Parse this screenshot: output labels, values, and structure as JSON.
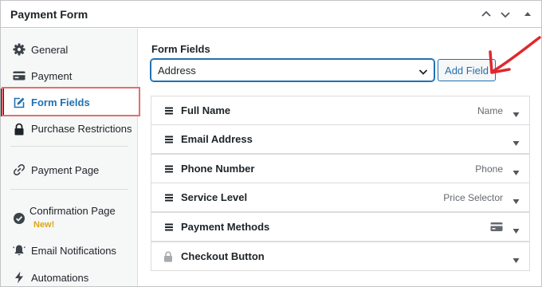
{
  "window": {
    "title": "Payment Form",
    "controls": [
      "collapse-up-icon",
      "move-down-icon",
      "toggle-panel-icon"
    ]
  },
  "sidebar": {
    "items": [
      {
        "label": "General",
        "icon": "gear-icon"
      },
      {
        "label": "Payment",
        "icon": "card-icon"
      },
      {
        "label": "Form Fields",
        "icon": "edit-icon",
        "active": true
      },
      {
        "label": "Purchase Restrictions",
        "icon": "lock-icon"
      },
      {
        "label": "Payment Page",
        "icon": "link-icon"
      },
      {
        "label": "Confirmation Page",
        "icon": "check-circle-icon",
        "badge": "New!"
      },
      {
        "label": "Email Notifications",
        "icon": "bell-icon"
      },
      {
        "label": "Automations",
        "icon": "bolt-icon"
      }
    ]
  },
  "main": {
    "section_title": "Form Fields",
    "field_select": {
      "value": "Address"
    },
    "add_button": "Add Field",
    "fields": [
      {
        "name": "Full Name",
        "type": "Name"
      },
      {
        "name": "Email Address",
        "type": ""
      },
      {
        "name": "Phone Number",
        "type": "Phone"
      },
      {
        "name": "Service Level",
        "type": "Price Selector"
      },
      {
        "name": "Payment Methods",
        "type": "",
        "icon": "credit-card-icon"
      },
      {
        "name": "Checkout Button",
        "type": "",
        "locked": true
      }
    ]
  },
  "colors": {
    "accent": "#2271b1",
    "highlight_box": "#e26f6f",
    "annotation_arrow": "#e0282e",
    "new_badge": "#dba617",
    "sidebar_bg": "#f6f7f7"
  }
}
